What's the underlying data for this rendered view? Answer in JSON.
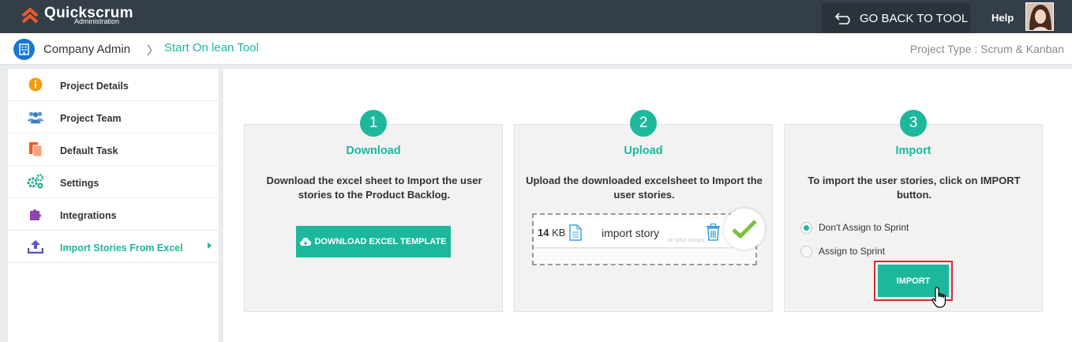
{
  "app": {
    "logo_title": "Quickscrum",
    "logo_subtitle": "Administration",
    "go_back_label": "GO BACK TO TOOL",
    "help_label": "Help"
  },
  "breadcrumb": {
    "company": "Company Admin",
    "separator": "〉",
    "current": "Start On lean Tool",
    "project_type": "Project Type : Scrum & Kanban"
  },
  "sidebar": {
    "items": [
      {
        "label": "Project Details",
        "icon": "info-icon"
      },
      {
        "label": "Project Team",
        "icon": "team-icon"
      },
      {
        "label": "Default Task",
        "icon": "task-icon"
      },
      {
        "label": "Settings",
        "icon": "gears-icon"
      },
      {
        "label": "Integrations",
        "icon": "puzzle-icon"
      },
      {
        "label": "Import Stories From Excel",
        "icon": "upload-icon",
        "active": true
      }
    ]
  },
  "steps": [
    {
      "number": "1",
      "title": "Download",
      "description": "Download the excel sheet to Import the user stories to the Product Backlog.",
      "button_label": "DOWNLOAD EXCEL TEMPLATE"
    },
    {
      "number": "2",
      "title": "Upload",
      "description": "Upload the downloaded excelsheet to Import the user stories.",
      "file": {
        "size_value": "14",
        "size_unit": "KB",
        "name": "import story",
        "hint": "on your compu"
      }
    },
    {
      "number": "3",
      "title": "Import",
      "description": "To import the user stories, click on IMPORT button.",
      "options": [
        {
          "label": "Don't Assign to Sprint",
          "checked": true
        },
        {
          "label": "Assign to Sprint",
          "checked": false
        }
      ],
      "button_label": "IMPORT"
    }
  ],
  "colors": {
    "accent": "#1db89c",
    "topbar": "#333e48",
    "highlight": "#d32f2f"
  }
}
